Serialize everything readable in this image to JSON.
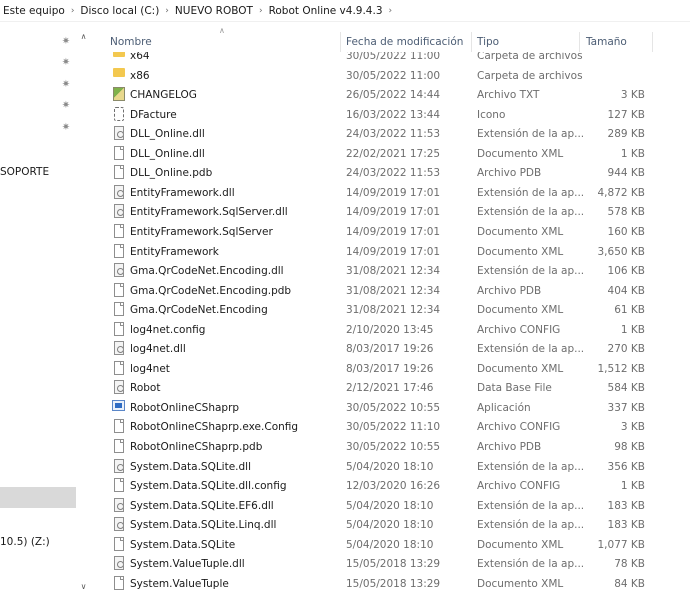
{
  "breadcrumb": [
    "Este equipo",
    "Disco local (C:)",
    "NUEVO ROBOT",
    "Robot Online v4.9.4.3"
  ],
  "nav": {
    "soporte_label": "SOPORTE",
    "drive_label": "10.5) (Z:)"
  },
  "columns": {
    "name": "Nombre",
    "date": "Fecha de modificación",
    "type": "Tipo",
    "size": "Tamaño"
  },
  "files": [
    {
      "name": "x64",
      "date": "30/05/2022 11:00",
      "type": "Carpeta de archivos",
      "size": "",
      "icon": "folder-icon"
    },
    {
      "name": "x86",
      "date": "30/05/2022 11:00",
      "type": "Carpeta de archivos",
      "size": "",
      "icon": "folder-icon"
    },
    {
      "name": "CHANGELOG",
      "date": "26/05/2022 14:44",
      "type": "Archivo TXT",
      "size": "3 KB",
      "icon": "text-file-icon"
    },
    {
      "name": "DFacture",
      "date": "16/03/2022 13:44",
      "type": "Icono",
      "size": "127 KB",
      "icon": "icon-file-icon"
    },
    {
      "name": "DLL_Online.dll",
      "date": "24/03/2022 11:53",
      "type": "Extensión de la ap...",
      "size": "289 KB",
      "icon": "dll-file-icon"
    },
    {
      "name": "DLL_Online.dll",
      "date": "22/02/2021 17:25",
      "type": "Documento XML",
      "size": "1 KB",
      "icon": "file-icon"
    },
    {
      "name": "DLL_Online.pdb",
      "date": "24/03/2022 11:53",
      "type": "Archivo PDB",
      "size": "944 KB",
      "icon": "file-icon"
    },
    {
      "name": "EntityFramework.dll",
      "date": "14/09/2019 17:01",
      "type": "Extensión de la ap...",
      "size": "4,872 KB",
      "icon": "dll-file-icon"
    },
    {
      "name": "EntityFramework.SqlServer.dll",
      "date": "14/09/2019 17:01",
      "type": "Extensión de la ap...",
      "size": "578 KB",
      "icon": "dll-file-icon"
    },
    {
      "name": "EntityFramework.SqlServer",
      "date": "14/09/2019 17:01",
      "type": "Documento XML",
      "size": "160 KB",
      "icon": "file-icon"
    },
    {
      "name": "EntityFramework",
      "date": "14/09/2019 17:01",
      "type": "Documento XML",
      "size": "3,650 KB",
      "icon": "file-icon"
    },
    {
      "name": "Gma.QrCodeNet.Encoding.dll",
      "date": "31/08/2021 12:34",
      "type": "Extensión de la ap...",
      "size": "106 KB",
      "icon": "dll-file-icon"
    },
    {
      "name": "Gma.QrCodeNet.Encoding.pdb",
      "date": "31/08/2021 12:34",
      "type": "Archivo PDB",
      "size": "404 KB",
      "icon": "file-icon"
    },
    {
      "name": "Gma.QrCodeNet.Encoding",
      "date": "31/08/2021 12:34",
      "type": "Documento XML",
      "size": "61 KB",
      "icon": "file-icon"
    },
    {
      "name": "log4net.config",
      "date": "2/10/2020 13:45",
      "type": "Archivo CONFIG",
      "size": "1 KB",
      "icon": "file-icon"
    },
    {
      "name": "log4net.dll",
      "date": "8/03/2017 19:26",
      "type": "Extensión de la ap...",
      "size": "270 KB",
      "icon": "dll-file-icon"
    },
    {
      "name": "log4net",
      "date": "8/03/2017 19:26",
      "type": "Documento XML",
      "size": "1,512 KB",
      "icon": "file-icon"
    },
    {
      "name": "Robot",
      "date": "2/12/2021 17:46",
      "type": "Data Base File",
      "size": "584 KB",
      "icon": "dll-file-icon"
    },
    {
      "name": "RobotOnlineCShaprp",
      "date": "30/05/2022 10:55",
      "type": "Aplicación",
      "size": "337 KB",
      "icon": "application-icon"
    },
    {
      "name": "RobotOnlineCShaprp.exe.Config",
      "date": "30/05/2022 11:10",
      "type": "Archivo CONFIG",
      "size": "3 KB",
      "icon": "file-icon"
    },
    {
      "name": "RobotOnlineCShaprp.pdb",
      "date": "30/05/2022 10:55",
      "type": "Archivo PDB",
      "size": "98 KB",
      "icon": "file-icon"
    },
    {
      "name": "System.Data.SQLite.dll",
      "date": "5/04/2020 18:10",
      "type": "Extensión de la ap...",
      "size": "356 KB",
      "icon": "dll-file-icon"
    },
    {
      "name": "System.Data.SQLite.dll.config",
      "date": "12/03/2020 16:26",
      "type": "Archivo CONFIG",
      "size": "1 KB",
      "icon": "file-icon"
    },
    {
      "name": "System.Data.SQLite.EF6.dll",
      "date": "5/04/2020 18:10",
      "type": "Extensión de la ap...",
      "size": "183 KB",
      "icon": "dll-file-icon"
    },
    {
      "name": "System.Data.SQLite.Linq.dll",
      "date": "5/04/2020 18:10",
      "type": "Extensión de la ap...",
      "size": "183 KB",
      "icon": "dll-file-icon"
    },
    {
      "name": "System.Data.SQLite",
      "date": "5/04/2020 18:10",
      "type": "Documento XML",
      "size": "1,077 KB",
      "icon": "file-icon"
    },
    {
      "name": "System.ValueTuple.dll",
      "date": "15/05/2018 13:29",
      "type": "Extensión de la ap...",
      "size": "78 KB",
      "icon": "dll-file-icon"
    },
    {
      "name": "System.ValueTuple",
      "date": "15/05/2018 13:29",
      "type": "Documento XML",
      "size": "84 KB",
      "icon": "file-icon"
    }
  ]
}
